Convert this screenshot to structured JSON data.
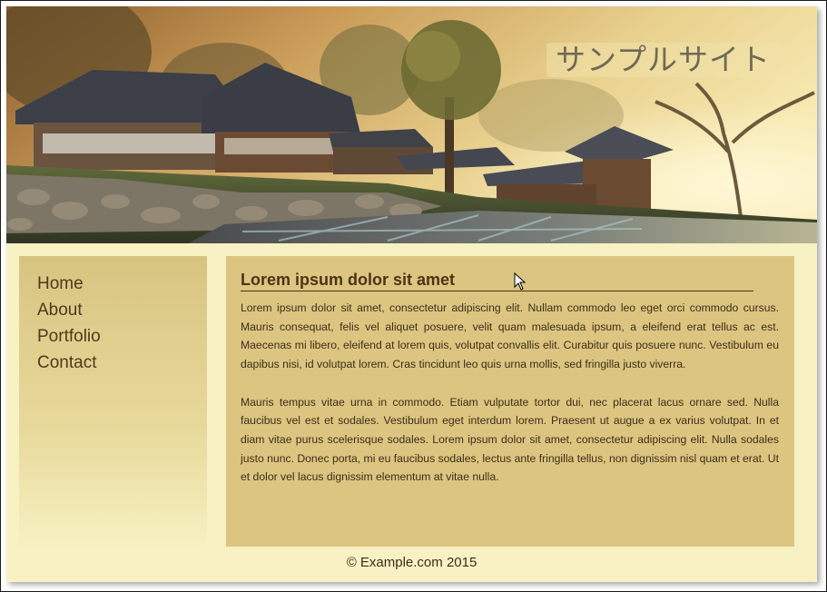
{
  "site": {
    "title": "サンプルサイト"
  },
  "nav": {
    "items": [
      {
        "label": "Home"
      },
      {
        "label": "About"
      },
      {
        "label": "Portfolio"
      },
      {
        "label": "Contact"
      }
    ]
  },
  "article": {
    "title": "Lorem ipsum dolor sit amet",
    "paragraphs": [
      "Lorem ipsum dolor sit amet, consectetur adipiscing elit. Nullam commodo leo eget orci commodo cursus. Mauris consequat, felis vel aliquet posuere, velit quam malesuada ipsum, a eleifend erat tellus ac est. Maecenas mi libero, eleifend at lorem quis, volutpat convallis elit. Curabitur quis posuere nunc. Vestibulum eu dapibus nisi, id volutpat lorem. Cras tincidunt leo quis urna mollis, sed fringilla justo viverra.",
      "Mauris tempus vitae urna in commodo. Etiam vulputate tortor dui, nec placerat lacus ornare sed. Nulla faucibus vel est et sodales. Vestibulum eget interdum lorem. Praesent ut augue a ex varius volutpat. In et diam vitae purus scelerisque sodales. Lorem ipsum dolor sit amet, consectetur adipiscing elit. Nulla sodales justo nunc. Donec porta, mi eu faucibus sodales, lectus ante fringilla tellus, non dignissim nisl quam et erat. Ut et dolor vel lacus dignissim elementum at vitae nulla."
    ]
  },
  "footer": {
    "text": "© Example.com 2015"
  },
  "colors": {
    "page_bg": "#f7f1c3",
    "content_bg": "#dcc580",
    "sidebar_top": "#d8c481",
    "text_dark": "#4a3417"
  },
  "icons": {
    "cursor": "arrow-cursor-icon"
  }
}
